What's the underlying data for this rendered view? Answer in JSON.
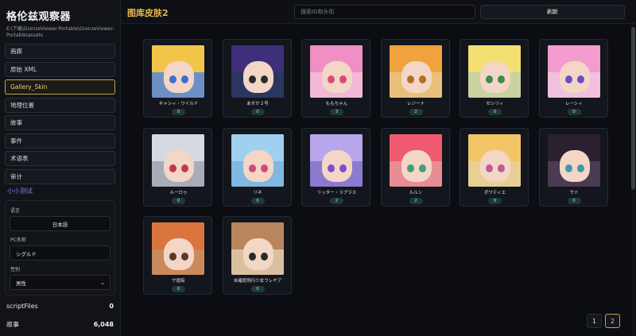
{
  "sidebar": {
    "title": "格伦兹观察器",
    "path": "E:\\下载\\GrenzeViewer-Portable\\GrenzeViewer-Portable\\assets",
    "nav": [
      {
        "label": "画廊",
        "active": false
      },
      {
        "label": "原始 XML",
        "active": false
      },
      {
        "label": "Gallery_Skin",
        "active": true
      },
      {
        "label": "地理位置",
        "active": false
      },
      {
        "label": "故事",
        "active": false
      },
      {
        "label": "事件",
        "active": false
      },
      {
        "label": "术语表",
        "active": false
      },
      {
        "label": "审计",
        "active": false
      }
    ],
    "section_title": "小小测试",
    "settings": {
      "language_label": "语言",
      "language_value": "日本語",
      "pc_name_label": "PC名称",
      "pc_name_value": "シグルド",
      "gender_label": "性别",
      "gender_value": "男性"
    },
    "stats": [
      {
        "label": "scriptFiles",
        "value": "0"
      },
      {
        "label": "故事",
        "value": "6,048"
      }
    ]
  },
  "main": {
    "title": "图库皮肤2",
    "search_placeholder": "搜索ID和头衔",
    "refresh_label": "刷新",
    "cards": [
      {
        "name": "キャシィ・ワイルド",
        "count": "0",
        "hair": "#f2c54a",
        "bg": "#6d8fc4",
        "eye": "#3b6fd0"
      },
      {
        "name": "あすか２号",
        "count": "0",
        "hair": "#3d2f7a",
        "bg": "#2a3560",
        "eye": "#2b2b2b"
      },
      {
        "name": "ももちゃん",
        "count": "3",
        "hair": "#f08fc3",
        "bg": "#f1b9d6",
        "eye": "#d94a7a"
      },
      {
        "name": "レジーナ",
        "count": "2",
        "hair": "#f0a33c",
        "bg": "#e8c07a",
        "eye": "#b07020"
      },
      {
        "name": "セシリィ",
        "count": "0",
        "hair": "#f3e070",
        "bg": "#c9d2a0",
        "eye": "#3f8a4a"
      },
      {
        "name": "レーシィ",
        "count": "0",
        "hair": "#f29ccf",
        "bg": "#f0c0de",
        "eye": "#6b4fc0"
      },
      {
        "name": "ルーロゥ",
        "count": "0",
        "hair": "#d6d8e2",
        "bg": "#a8acb8",
        "eye": "#c0394a"
      },
      {
        "name": "リネ",
        "count": "0",
        "hair": "#9fd0ef",
        "bg": "#7fb8e0",
        "eye": "#d04a74"
      },
      {
        "name": "リッター・ラプラス",
        "count": "2",
        "hair": "#b7a6ec",
        "bg": "#8c7ad0",
        "eye": "#7a4fd0"
      },
      {
        "name": "ルルン",
        "count": "2",
        "hair": "#ef5a6e",
        "bg": "#e88c96",
        "eye": "#3fa07a"
      },
      {
        "name": "ポワティエ",
        "count": "0",
        "hair": "#f2c666",
        "bg": "#e8cf95",
        "eye": "#c05a9a"
      },
      {
        "name": "サナ",
        "count": "0",
        "hair": "#2a2030",
        "bg": "#4a3a52",
        "eye": "#3a9ab0"
      },
      {
        "name": "宁眉街",
        "count": "0",
        "hair": "#d9753c",
        "bg": "#c98a5e",
        "eye": "#5a3a2a"
      },
      {
        "name": "未確認飛行少女ウレヤア",
        "count": "0",
        "hair": "#b9855c",
        "bg": "#d8c0a0",
        "eye": "#2a2a2a"
      }
    ],
    "pagination": [
      {
        "label": "1",
        "active": false
      },
      {
        "label": "2",
        "active": true
      }
    ]
  }
}
